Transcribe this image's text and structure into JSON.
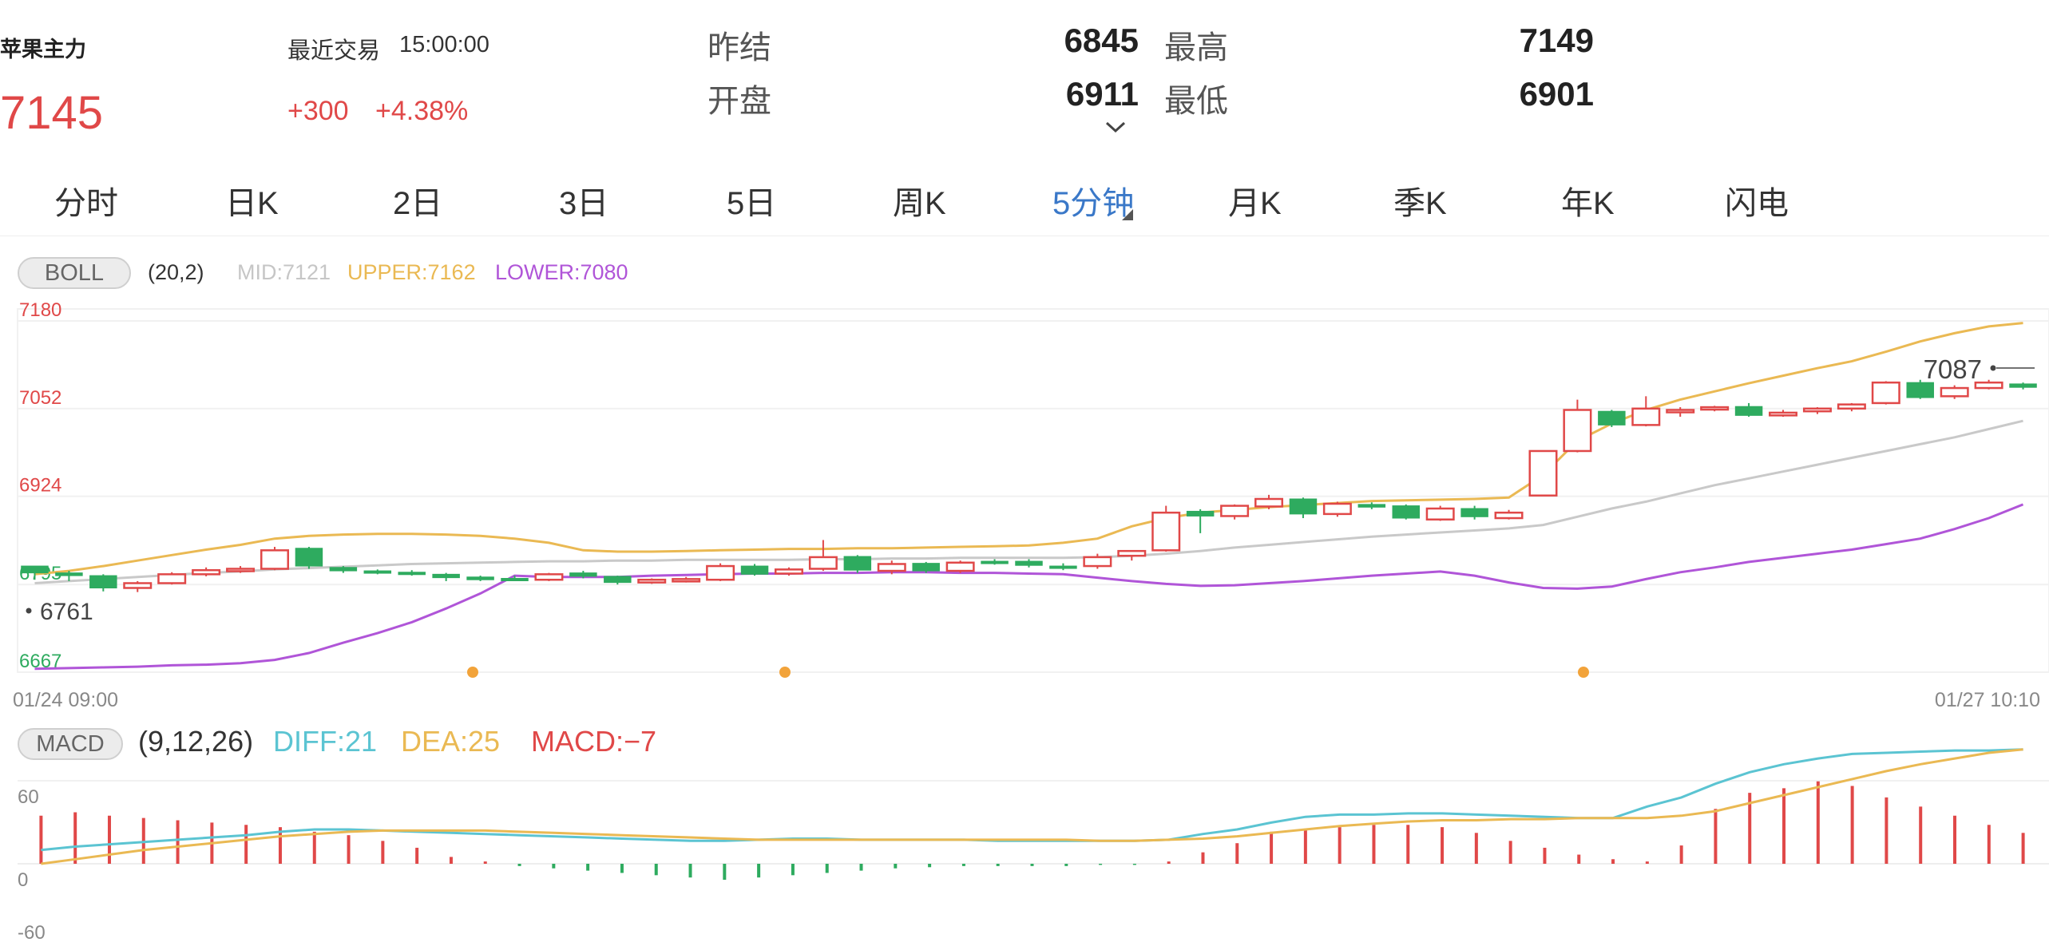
{
  "header": {
    "title": "苹果主力",
    "price": "7145",
    "time_label": "最近交易",
    "time_value": "15:00:00",
    "change": "+300",
    "change_pct": "+4.38%",
    "prev_settle_label": "昨结",
    "prev_settle_value": "6845",
    "open_label": "开盘",
    "open_value": "6911",
    "high_label": "最高",
    "high_value": "7149",
    "low_label": "最低",
    "low_value": "6901"
  },
  "tabs": [
    {
      "label": "分时",
      "active": false
    },
    {
      "label": "日K",
      "active": false
    },
    {
      "label": "2日",
      "active": false
    },
    {
      "label": "3日",
      "active": false
    },
    {
      "label": "5日",
      "active": false
    },
    {
      "label": "周K",
      "active": false
    },
    {
      "label": "5分钟",
      "active": true
    },
    {
      "label": "月K",
      "active": false
    },
    {
      "label": "季K",
      "active": false
    },
    {
      "label": "年K",
      "active": false
    },
    {
      "label": "闪电",
      "active": false
    }
  ],
  "indicators": {
    "boll": {
      "name": "BOLL",
      "params": "(20,2)",
      "mid": "MID:7121",
      "upper": "UPPER:7162",
      "lower": "LOWER:7080"
    },
    "macd": {
      "name": "MACD",
      "params": "(9,12,26)",
      "diff": "DIFF:21",
      "dea": "DEA:25",
      "macd": "MACD:−7"
    }
  },
  "colors": {
    "up": "#e04848",
    "down": "#2eab5f",
    "mid": "#c9c9c9",
    "upper": "#eab953",
    "lower": "#b055d8",
    "diff": "#5bc4d2",
    "dea": "#eab953",
    "active_tab": "#3a78c8"
  },
  "chart_data": [
    {
      "type": "candlestick",
      "y_tick_labels": [
        "7180",
        "7052",
        "6924",
        "6795",
        "6667"
      ],
      "ylim": [
        6667,
        7180
      ],
      "x_start_label": "01/24 09:00",
      "x_end_label": "01/27 10:10",
      "marker_high": "7087",
      "marker_low": "6761",
      "candles": [
        [
          6822,
          6822,
          6802,
          6812
        ],
        [
          6812,
          6815,
          6800,
          6808
        ],
        [
          6808,
          6810,
          6785,
          6790
        ],
        [
          6790,
          6800,
          6784,
          6797
        ],
        [
          6797,
          6813,
          6795,
          6810
        ],
        [
          6810,
          6820,
          6807,
          6816
        ],
        [
          6815,
          6822,
          6812,
          6818
        ],
        [
          6818,
          6850,
          6816,
          6845
        ],
        [
          6848,
          6850,
          6818,
          6822
        ],
        [
          6820,
          6822,
          6812,
          6815
        ],
        [
          6815,
          6817,
          6810,
          6812
        ],
        [
          6813,
          6816,
          6808,
          6810
        ],
        [
          6810,
          6812,
          6800,
          6805
        ],
        [
          6806,
          6808,
          6800,
          6802
        ],
        [
          6804,
          6808,
          6800,
          6803
        ],
        [
          6802,
          6812,
          6800,
          6810
        ],
        [
          6812,
          6815,
          6804,
          6807
        ],
        [
          6807,
          6808,
          6795,
          6798
        ],
        [
          6798,
          6804,
          6796,
          6802
        ],
        [
          6801,
          6806,
          6798,
          6803
        ],
        [
          6802,
          6826,
          6800,
          6822
        ],
        [
          6822,
          6825,
          6808,
          6810
        ],
        [
          6811,
          6820,
          6808,
          6817
        ],
        [
          6818,
          6860,
          6815,
          6835
        ],
        [
          6836,
          6838,
          6812,
          6816
        ],
        [
          6815,
          6830,
          6810,
          6825
        ],
        [
          6826,
          6828,
          6812,
          6815
        ],
        [
          6815,
          6830,
          6812,
          6827
        ],
        [
          6829,
          6832,
          6824,
          6827
        ],
        [
          6829,
          6832,
          6820,
          6823
        ],
        [
          6822,
          6826,
          6816,
          6820
        ],
        [
          6822,
          6840,
          6818,
          6835
        ],
        [
          6837,
          6845,
          6830,
          6844
        ],
        [
          6845,
          6910,
          6843,
          6900
        ],
        [
          6902,
          6905,
          6870,
          6895
        ],
        [
          6895,
          6912,
          6890,
          6910
        ],
        [
          6909,
          6926,
          6905,
          6920
        ],
        [
          6920,
          6922,
          6892,
          6898
        ],
        [
          6898,
          6916,
          6894,
          6913
        ],
        [
          6912,
          6915,
          6905,
          6908
        ],
        [
          6910,
          6912,
          6890,
          6892
        ],
        [
          6890,
          6910,
          6888,
          6906
        ],
        [
          6906,
          6910,
          6890,
          6894
        ],
        [
          6892,
          6904,
          6890,
          6900
        ],
        [
          6925,
          6945,
          6925,
          6990
        ],
        [
          6990,
          7065,
          6988,
          7050
        ],
        [
          7048,
          7050,
          7025,
          7028
        ],
        [
          7028,
          7070,
          7026,
          7052
        ],
        [
          7048,
          7054,
          7040,
          7050
        ],
        [
          7052,
          7056,
          7048,
          7054
        ],
        [
          7055,
          7060,
          7040,
          7042
        ],
        [
          7042,
          7050,
          7040,
          7046
        ],
        [
          7048,
          7054,
          7044,
          7052
        ],
        [
          7052,
          7060,
          7048,
          7058
        ],
        [
          7060,
          7092,
          7058,
          7090
        ],
        [
          7090,
          7094,
          7066,
          7068
        ],
        [
          7070,
          7086,
          7066,
          7082
        ],
        [
          7082,
          7094,
          7080,
          7090
        ],
        [
          7088,
          7090,
          7080,
          7083
        ]
      ],
      "boll_mid": [
        6797,
        6800,
        6803,
        6806,
        6809,
        6812,
        6814,
        6817,
        6819,
        6821,
        6823,
        6825,
        6826,
        6827,
        6828,
        6829,
        6829,
        6830,
        6830,
        6831,
        6831,
        6831,
        6831,
        6832,
        6832,
        6833,
        6833,
        6834,
        6834,
        6834,
        6834,
        6835,
        6837,
        6840,
        6844,
        6849,
        6853,
        6857,
        6861,
        6865,
        6868,
        6871,
        6874,
        6877,
        6882,
        6894,
        6906,
        6916,
        6928,
        6940,
        6950,
        6960,
        6970,
        6980,
        6990,
        7000,
        7010,
        7022,
        7034
      ],
      "boll_upper": [
        6810,
        6815,
        6822,
        6830,
        6838,
        6846,
        6853,
        6862,
        6866,
        6868,
        6869,
        6869,
        6868,
        6866,
        6862,
        6856,
        6845,
        6843,
        6843,
        6844,
        6845,
        6846,
        6847,
        6847,
        6848,
        6848,
        6849,
        6850,
        6851,
        6852,
        6856,
        6862,
        6880,
        6892,
        6900,
        6904,
        6908,
        6911,
        6914,
        6917,
        6918,
        6919,
        6920,
        6922,
        6955,
        7005,
        7030,
        7050,
        7065,
        7077,
        7089,
        7100,
        7111,
        7121,
        7135,
        7150,
        7162,
        7172,
        7177
      ],
      "boll_lower": [
        6672,
        6673,
        6674,
        6675,
        6677,
        6678,
        6680,
        6685,
        6695,
        6710,
        6724,
        6740,
        6760,
        6782,
        6808,
        6806,
        6806,
        6806,
        6808,
        6809,
        6810,
        6811,
        6811,
        6812,
        6812,
        6813,
        6813,
        6812,
        6812,
        6811,
        6810,
        6805,
        6800,
        6796,
        6793,
        6794,
        6797,
        6800,
        6804,
        6808,
        6811,
        6814,
        6808,
        6798,
        6790,
        6789,
        6792,
        6803,
        6813,
        6820,
        6828,
        6834,
        6840,
        6846,
        6854,
        6862,
        6876,
        6892,
        6912
      ]
    },
    {
      "type": "bar+line",
      "y_tick_labels": [
        "60",
        "0",
        "-60"
      ],
      "ylim": [
        -60,
        60
      ],
      "hist": [
        42,
        45,
        42,
        40,
        38,
        36,
        34,
        32,
        28,
        25,
        20,
        14,
        6,
        2,
        -2,
        -4,
        -6,
        -8,
        -10,
        -12,
        -14,
        -12,
        -10,
        -8,
        -6,
        -4,
        -3,
        -2,
        -2,
        -2,
        -2,
        -1,
        -1,
        2,
        10,
        18,
        28,
        30,
        32,
        34,
        34,
        32,
        27,
        20,
        14,
        8,
        4,
        2,
        16,
        48,
        62,
        66,
        72,
        68,
        58,
        50,
        42,
        34,
        27
      ],
      "diff": [
        12,
        15,
        17,
        19,
        21,
        23,
        25,
        28,
        30,
        30,
        29,
        28,
        27,
        26,
        25,
        24,
        23,
        22,
        21,
        20,
        20,
        21,
        22,
        22,
        21,
        21,
        21,
        21,
        20,
        20,
        20,
        20,
        20,
        21,
        26,
        30,
        36,
        41,
        43,
        43,
        44,
        44,
        43,
        42,
        41,
        40,
        40,
        50,
        58,
        70,
        80,
        87,
        92,
        96,
        97,
        98,
        99,
        99,
        100
      ],
      "dea": [
        0,
        4,
        8,
        12,
        15,
        18,
        21,
        24,
        26,
        28,
        29,
        29,
        29,
        29,
        28,
        27,
        26,
        25,
        24,
        23,
        22,
        21,
        21,
        21,
        21,
        21,
        21,
        21,
        21,
        21,
        21,
        20,
        20,
        21,
        22,
        24,
        27,
        30,
        33,
        35,
        37,
        38,
        38,
        39,
        39,
        40,
        40,
        40,
        42,
        46,
        53,
        60,
        67,
        74,
        81,
        87,
        92,
        97,
        100
      ]
    }
  ]
}
